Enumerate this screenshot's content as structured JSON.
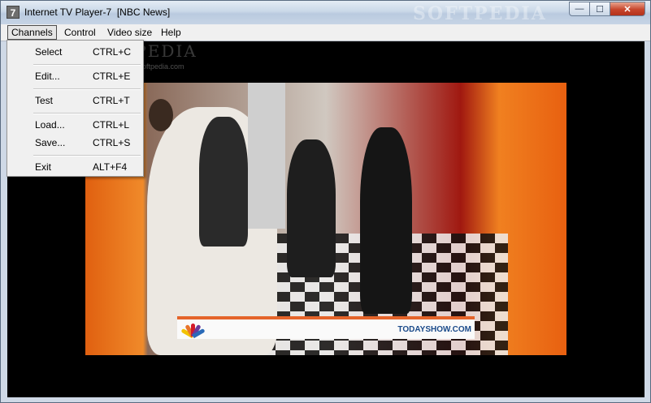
{
  "window": {
    "app_icon": "7",
    "title": "Internet TV Player-7  [NBC News]",
    "watermark": "SOFTPEDIA",
    "buttons": {
      "minimize": "—",
      "maximize": "☐",
      "close": "✕"
    }
  },
  "menubar": {
    "items": [
      {
        "label": "Channels",
        "open": true
      },
      {
        "label": "Control"
      },
      {
        "label": "Video size"
      },
      {
        "label": "Help"
      }
    ]
  },
  "channels_menu": {
    "items": [
      {
        "label": "Select",
        "accel": "CTRL+C"
      },
      {
        "label": "Edit...",
        "accel": "CTRL+E"
      },
      {
        "label": "Test",
        "accel": "CTRL+T"
      },
      {
        "label": "Load...",
        "accel": "CTRL+L"
      },
      {
        "label": "Save...",
        "accel": "CTRL+S"
      },
      {
        "label": "Exit",
        "accel": "ALT+F4"
      }
    ]
  },
  "video": {
    "watermark": "SOFTPEDIA",
    "watermark_url": "www.softpedia.com",
    "ticker_text": "TODAYSHOW.COM",
    "channel_logo": "nbc-peacock-icon"
  }
}
